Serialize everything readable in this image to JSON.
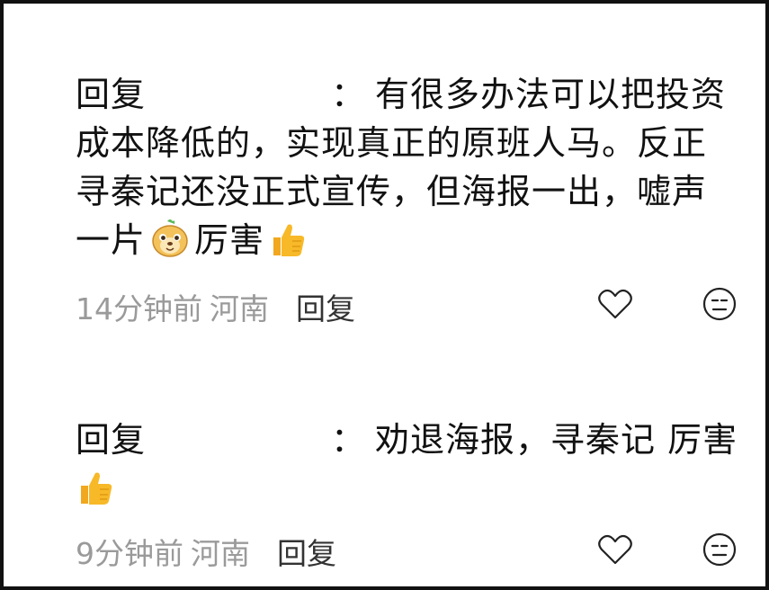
{
  "comments": [
    {
      "reply_prefix": "回复",
      "colon": "：",
      "text_a": "有很多办法可以把投资",
      "text_b": "成本降低的，实现真正的原班人马。反正",
      "text_c": "寻秦记还没正式宣传，但海报一出，嘘声",
      "text_d": "一片",
      "text_e": "厉害",
      "emojis": [
        "squirrel-face-emoji",
        "thumbs-up-emoji"
      ],
      "meta": {
        "time": "14分钟前",
        "location": "河南",
        "reply_label": "回复"
      },
      "actions": [
        "heart-icon",
        "emoji-face-icon"
      ]
    },
    {
      "reply_prefix": "回复",
      "colon": "：",
      "text_a": "劝退海报，寻秦记 厉害",
      "emojis": [
        "thumbs-up-emoji"
      ],
      "meta": {
        "time": "9分钟前",
        "location": "河南",
        "reply_label": "回复"
      },
      "actions": [
        "heart-icon",
        "emoji-face-icon"
      ]
    }
  ],
  "colors": {
    "text": "#111111",
    "muted": "#9a9a9a",
    "emoji_yellow": "#f7b928"
  }
}
